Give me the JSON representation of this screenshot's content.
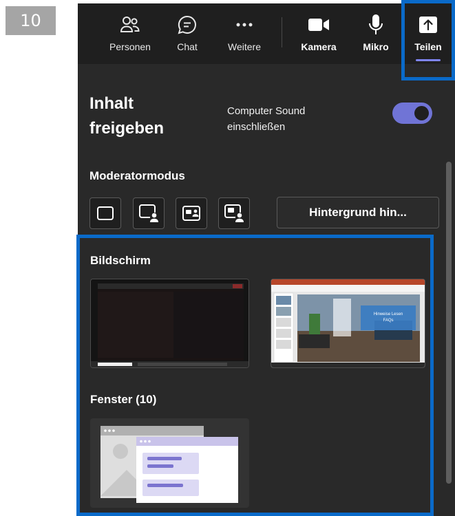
{
  "step_number": "10",
  "toolbar": {
    "people_label": "Personen",
    "chat_label": "Chat",
    "more_label": "Weitere",
    "camera_label": "Kamera",
    "mic_label": "Mikro",
    "share_label": "Teilen"
  },
  "share_panel": {
    "title_line1": "Inhalt",
    "title_line2": "freigeben",
    "sound_label_line1": "Computer Sound",
    "sound_label_line2": "einschließen",
    "sound_toggle_on": true,
    "presenter_mode_heading": "Moderatormodus",
    "background_button": "Hintergrund hin...",
    "screen_heading": "Bildschirm",
    "windows_heading": "Fenster (10)",
    "slide_text_line1": "Hinweise Lesen",
    "slide_text_line2": "FAQs"
  },
  "colors": {
    "highlight": "#0a6ac9",
    "toggle_accent": "#7074d6",
    "panel_bg": "#292929",
    "toolbar_bg": "#1f1f1f"
  }
}
